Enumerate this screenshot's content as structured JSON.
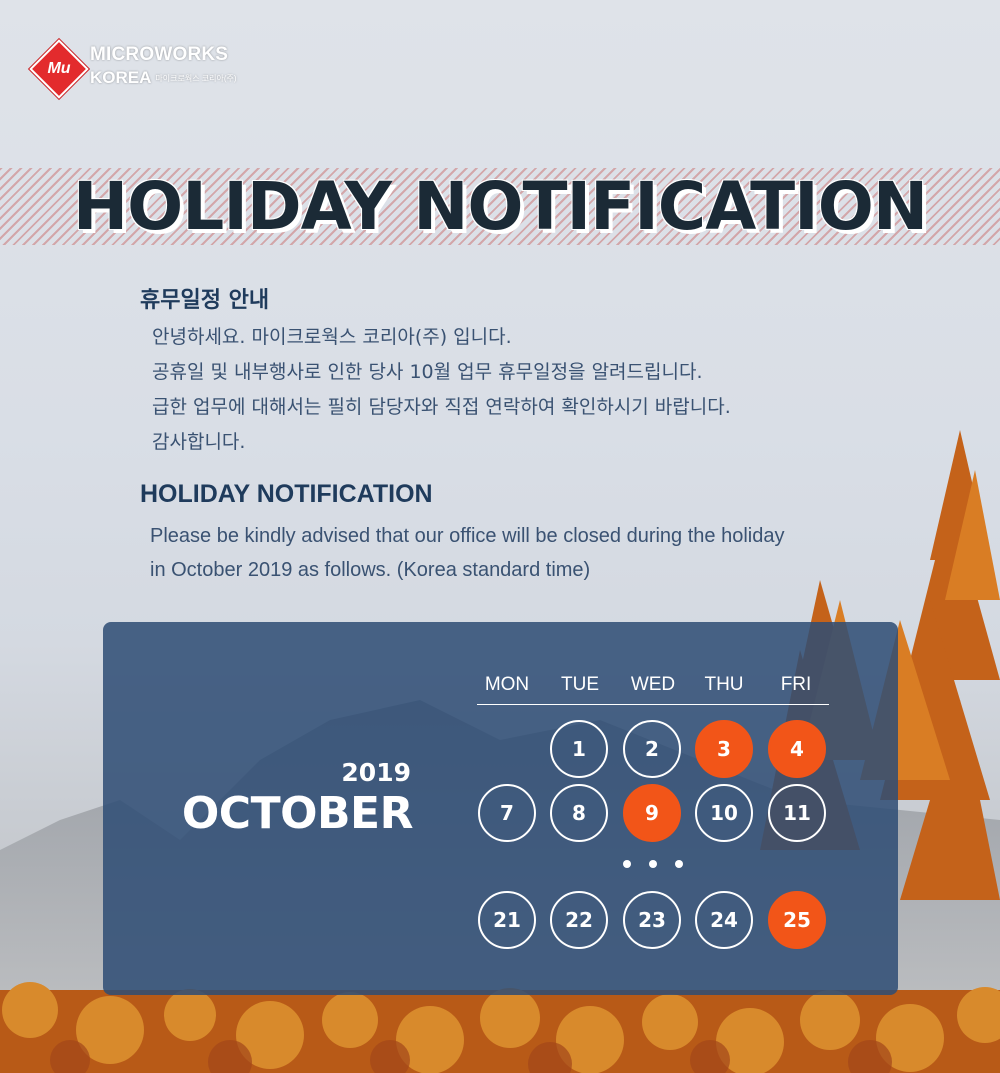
{
  "logo": {
    "mark_text": "Mu",
    "name": "MICROWORKS",
    "sub": "KOREA",
    "sub_small": "마이크로웍스 코리아(주)"
  },
  "title": "HOLIDAY NOTIFICATION",
  "korean": {
    "heading": "휴무일정 안내",
    "lines": [
      "안녕하세요. 마이크로웍스 코리아(주) 입니다.",
      "공휴일 및 내부행사로 인한 당사 10월 업무 휴무일정을 알려드립니다.",
      "급한 업무에 대해서는 필히 담당자와 직접 연락하여 확인하시기 바랍니다.",
      "감사합니다."
    ]
  },
  "english": {
    "heading": "HOLIDAY NOTIFICATION",
    "lines": [
      "Please be kindly advised that our office will be closed during the holiday",
      "in October 2019 as follows. (Korea standard time)"
    ]
  },
  "calendar": {
    "year": "2019",
    "month": "OCTOBER",
    "weekdays": [
      "MON",
      "TUE",
      "WED",
      "THU",
      "FRI"
    ],
    "weeks": [
      [
        {
          "d": ""
        },
        {
          "d": "1"
        },
        {
          "d": "2"
        },
        {
          "d": "3",
          "holiday": true
        },
        {
          "d": "4",
          "holiday": true
        }
      ],
      [
        {
          "d": "7"
        },
        {
          "d": "8"
        },
        {
          "d": "9",
          "holiday": true
        },
        {
          "d": "10"
        },
        {
          "d": "11"
        }
      ],
      [
        {
          "d": "21"
        },
        {
          "d": "22"
        },
        {
          "d": "23"
        },
        {
          "d": "24"
        },
        {
          "d": "25",
          "holiday": true
        }
      ]
    ],
    "holiday_color": "#f25518",
    "panel_color": "#2e4d74"
  },
  "colors": {
    "accent": "#f25518",
    "heading": "#1f3b5c",
    "body_text": "#3a5272",
    "logo_red": "#e32b2d"
  }
}
